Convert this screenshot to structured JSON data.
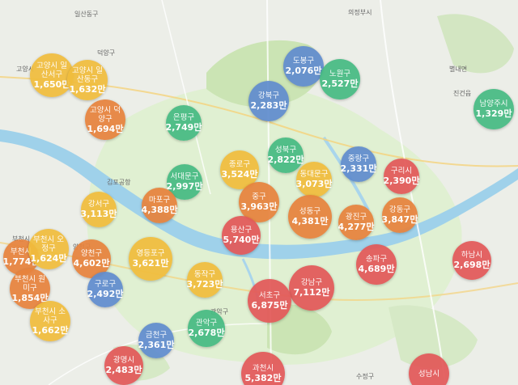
{
  "unit": "만",
  "districts": [
    {
      "id": "dobong",
      "name": "도봉구",
      "price": "2,076만",
      "color": "blue"
    },
    {
      "id": "nowon",
      "name": "노원구",
      "price": "2,527만",
      "color": "green"
    },
    {
      "id": "gangbuk",
      "name": "강북구",
      "price": "2,283만",
      "color": "blue"
    },
    {
      "id": "eunpyeong",
      "name": "은평구",
      "price": "2,749만",
      "color": "green"
    },
    {
      "id": "seongbuk",
      "name": "성북구",
      "price": "2,822만",
      "color": "green"
    },
    {
      "id": "jungnang",
      "name": "중랑구",
      "price": "2,331만",
      "color": "blue"
    },
    {
      "id": "guri",
      "name": "구리시",
      "price": "2,390만",
      "color": "red"
    },
    {
      "id": "namyangju",
      "name": "남양주시",
      "price": "1,329만",
      "color": "green"
    },
    {
      "id": "jongno",
      "name": "종로구",
      "price": "3,524만",
      "color": "yellow"
    },
    {
      "id": "dongdaemun",
      "name": "동대문구",
      "price": "3,073만",
      "color": "yellow"
    },
    {
      "id": "seodaemun",
      "name": "서대문구",
      "price": "2,997만",
      "color": "green"
    },
    {
      "id": "junggu",
      "name": "중구",
      "price": "3,963만",
      "color": "orange"
    },
    {
      "id": "mapo",
      "name": "마포구",
      "price": "4,388만",
      "color": "orange"
    },
    {
      "id": "seongdong",
      "name": "성동구",
      "price": "4,381만",
      "color": "orange"
    },
    {
      "id": "gwangjin",
      "name": "광진구",
      "price": "4,277만",
      "color": "orange"
    },
    {
      "id": "gangdong",
      "name": "강동구",
      "price": "3,847만",
      "color": "orange"
    },
    {
      "id": "gangseo",
      "name": "강서구",
      "price": "3,113만",
      "color": "yellow"
    },
    {
      "id": "yongsan",
      "name": "용산구",
      "price": "5,740만",
      "color": "red"
    },
    {
      "id": "yeongdeungpo",
      "name": "영등포구",
      "price": "3,621만",
      "color": "yellow"
    },
    {
      "id": "yangcheon",
      "name": "양천구",
      "price": "4,602만",
      "color": "orange"
    },
    {
      "id": "songpa",
      "name": "송파구",
      "price": "4,689만",
      "color": "red"
    },
    {
      "id": "hanam",
      "name": "하남시",
      "price": "2,698만",
      "color": "red"
    },
    {
      "id": "dongjak",
      "name": "동작구",
      "price": "3,723만",
      "color": "yellow"
    },
    {
      "id": "gangnam",
      "name": "강남구",
      "price": "7,112만",
      "color": "red"
    },
    {
      "id": "seocho",
      "name": "서초구",
      "price": "6,875만",
      "color": "red"
    },
    {
      "id": "guro",
      "name": "구로구",
      "price": "2,492만",
      "color": "blue"
    },
    {
      "id": "geumcheon",
      "name": "금천구",
      "price": "2,361만",
      "color": "blue"
    },
    {
      "id": "gwanak",
      "name": "관악구",
      "price": "2,678만",
      "color": "green"
    },
    {
      "id": "bucheon",
      "name": "부천시",
      "price": "1,774만",
      "color": "orange"
    },
    {
      "id": "gwangmyeong",
      "name": "광명시",
      "price": "2,483만",
      "color": "red"
    },
    {
      "id": "gwacheon",
      "name": "과천시",
      "price": "5,382만",
      "color": "red"
    },
    {
      "id": "seongnam",
      "name": "성남시",
      "price": "",
      "color": "red"
    },
    {
      "id": "goyang_ilsan",
      "name": "고양시 일산서구",
      "price": "1,650만",
      "color": "yellow"
    },
    {
      "id": "goyang_ilsandong",
      "name": "고양시 일산동구",
      "price": "1,632만",
      "color": "yellow"
    },
    {
      "id": "goyang_deogyang",
      "name": "고양시 덕양구",
      "price": "1,694만",
      "color": "orange"
    },
    {
      "id": "bucheon_ojeong",
      "name": "부천시 오정구",
      "price": "1,624만",
      "color": "yellow"
    },
    {
      "id": "bucheon_wonmi",
      "name": "부천시 원미구",
      "price": "1,854만",
      "color": "orange"
    },
    {
      "id": "bucheon_sosa",
      "name": "부천시 소사구",
      "price": "1,662만",
      "color": "yellow"
    }
  ],
  "map_labels": [
    "일산동구",
    "덕양구",
    "의정부시",
    "별내면",
    "진건읍",
    "고양시",
    "부천시",
    "김포공항",
    "관악구",
    "양천구",
    "수정구"
  ]
}
